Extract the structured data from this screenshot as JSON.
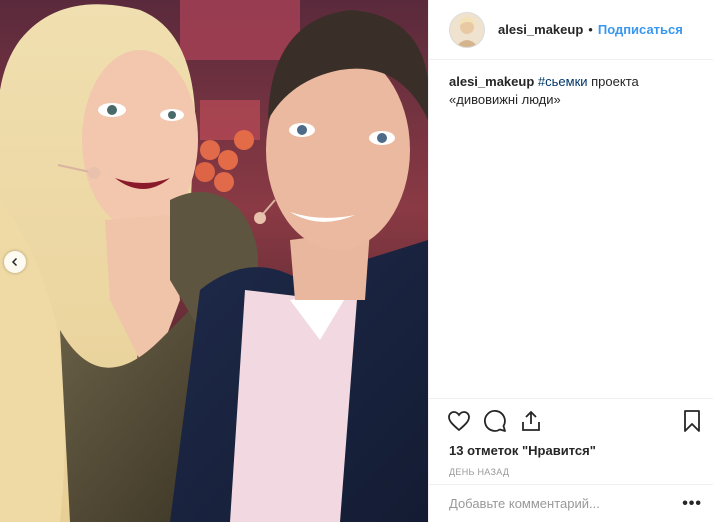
{
  "post": {
    "photo_alt": "selfie of a blonde woman and a man in a dark suit",
    "prev_icon": "chevron-left-icon"
  },
  "header": {
    "username": "alesi_makeup",
    "separator": "•",
    "follow_label": "Подписаться"
  },
  "caption": {
    "username": "alesi_makeup",
    "hashtag": "#сьемки",
    "text": " проекта «дивовижні люди»"
  },
  "actions": {
    "icons": [
      "heart-icon",
      "comment-icon",
      "share-icon",
      "bookmark-icon"
    ],
    "likes_text": "13 отметок \"Нравится\"",
    "timestamp": "День назад"
  },
  "comment": {
    "placeholder": "Добавьте комментарий...",
    "more_label": "•••"
  },
  "colors": {
    "accent": "#3897f0",
    "hashtag": "#003569",
    "border": "#efefef",
    "muted": "#999999"
  }
}
